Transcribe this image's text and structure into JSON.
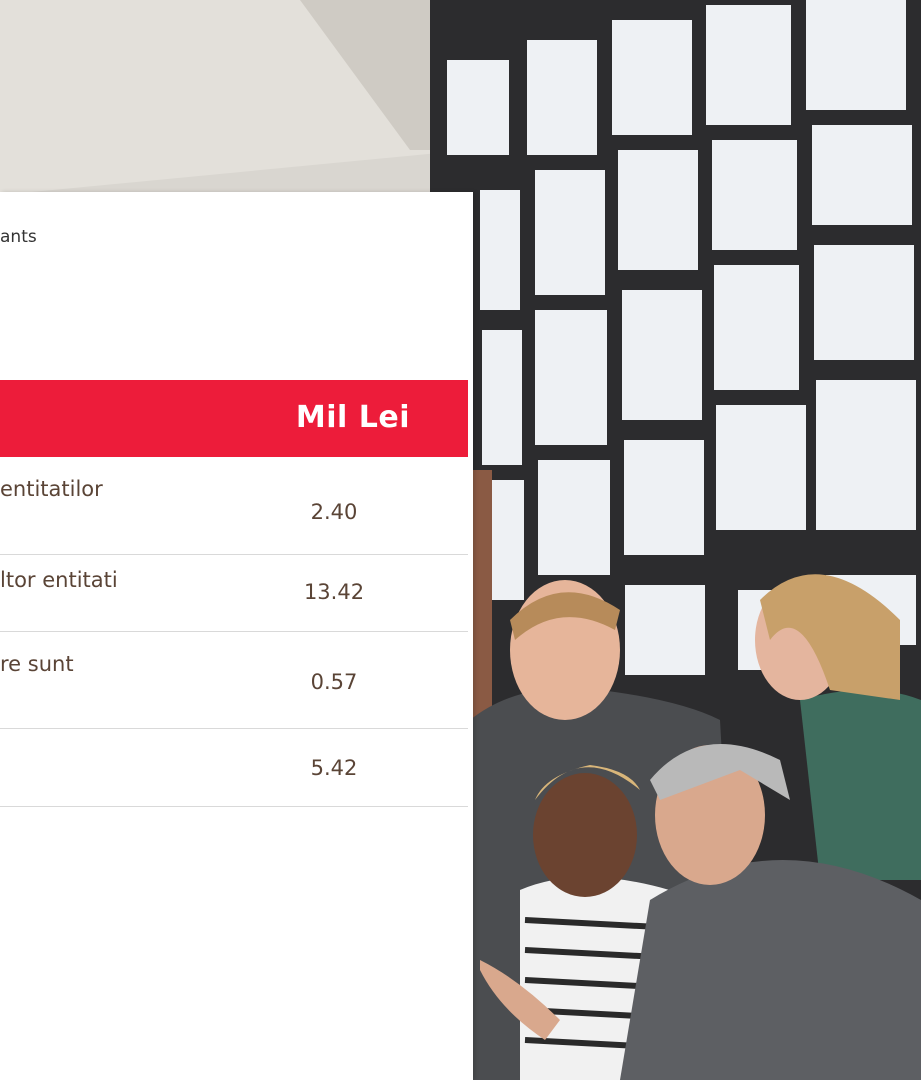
{
  "header": {
    "subtitle_fragment": "ants"
  },
  "table": {
    "unit_header": "Mil Lei",
    "rows": [
      {
        "label": "entitatilor",
        "value": "2.40"
      },
      {
        "label": "ltor entitati",
        "value": "13.42"
      },
      {
        "label": "re sunt",
        "value": "0.57"
      },
      {
        "label": "",
        "value": "5.42"
      }
    ]
  },
  "colors": {
    "header_red": "#ed1c3a",
    "row_text": "#5a4436",
    "panel": "#ffffff"
  },
  "photo": {
    "icon": "office-team-photo"
  }
}
